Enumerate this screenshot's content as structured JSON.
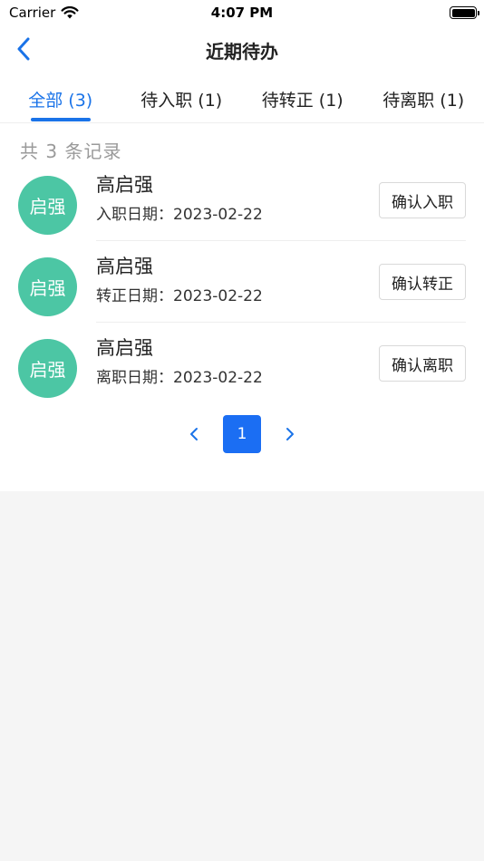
{
  "status_bar": {
    "carrier": "Carrier",
    "time": "4:07 PM"
  },
  "nav": {
    "title": "近期待办"
  },
  "tabs": [
    {
      "label": "全部 (3)",
      "active": true
    },
    {
      "label": "待入职 (1)",
      "active": false
    },
    {
      "label": "待转正 (1)",
      "active": false
    },
    {
      "label": "待离职 (1)",
      "active": false
    }
  ],
  "record_count": "共 3 条记录",
  "items": [
    {
      "avatar": "启强",
      "name": "高启强",
      "date_line": "入职日期：2023-02-22",
      "action": "确认入职"
    },
    {
      "avatar": "启强",
      "name": "高启强",
      "date_line": "转正日期：2023-02-22",
      "action": "确认转正"
    },
    {
      "avatar": "启强",
      "name": "高启强",
      "date_line": "离职日期：2023-02-22",
      "action": "确认离职"
    }
  ],
  "pagination": {
    "current": "1"
  },
  "colors": {
    "accent": "#1a73e8",
    "avatar_bg": "#4cc6a4",
    "page_active": "#1b6ef3"
  },
  "icons": {
    "back": "chevron-left-icon",
    "wifi": "wifi-icon",
    "battery": "battery-icon",
    "prev": "chevron-left-icon",
    "next": "chevron-right-icon"
  }
}
